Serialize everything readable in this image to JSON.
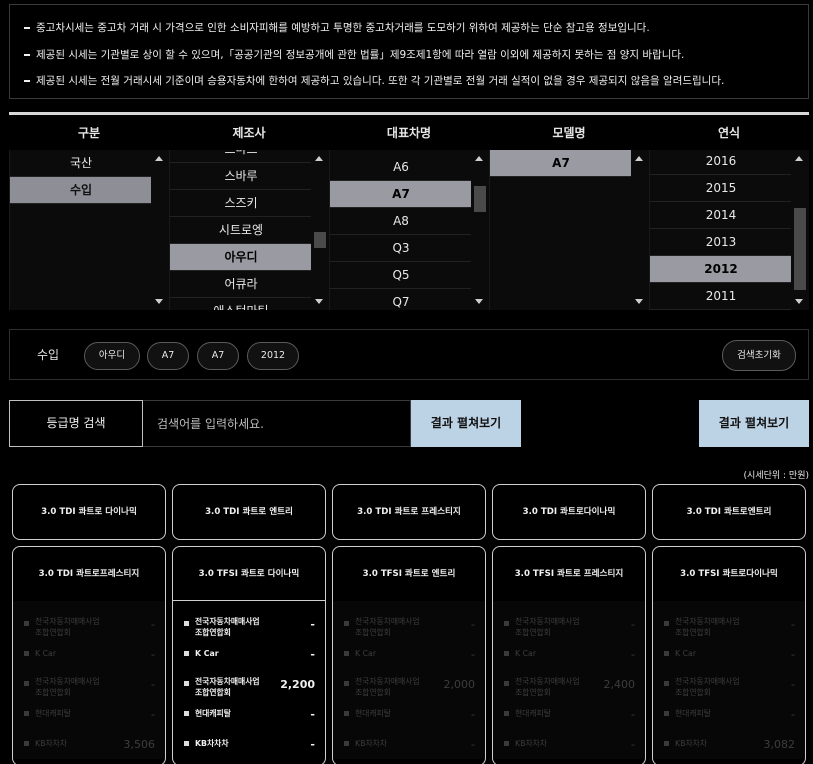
{
  "notice": [
    "중고차시세는 중고차 거래 시 가격으로 인한 소비자피해를 예방하고 투명한 중고차거래를 도모하기 위하여 제공하는 단순 참고용 정보입니다.",
    "제공된 시세는 기관별로 상이 할 수 있으며,「공공기관의 정보공개에 관한 법률」제9조제1항에 따라 열람 이외에 제공하지 못하는 점 양지 바랍니다.",
    "제공된 시세는 전월 거래시세 기준이며 승용자동차에 한하여 제공하고 있습니다. 또한 각 기관별로 전월 거래 실적이 없을 경우 제공되지 않음을 알려드립니다."
  ],
  "selector": {
    "headers": [
      "구분",
      "제조사",
      "대표차명",
      "모델명",
      "연식"
    ],
    "category": {
      "items": [
        "국산",
        "수입"
      ],
      "selected": 1
    },
    "maker": {
      "items": [
        "스마트",
        "스바루",
        "스즈키",
        "시트로엥",
        "아우디",
        "어큐라",
        "애스턴마틴"
      ],
      "selected": 4
    },
    "car": {
      "items": [
        "A6",
        "A7",
        "A8",
        "Q3",
        "Q5",
        "Q7"
      ],
      "selected": 1
    },
    "model": {
      "items": [
        "A7"
      ],
      "selected": 0
    },
    "year": {
      "items": [
        "2016",
        "2015",
        "2014",
        "2013",
        "2012",
        "2011"
      ],
      "selected": 4
    }
  },
  "chosen": {
    "label": "수입",
    "chips": [
      "아우디",
      "A7",
      "A7",
      "2012"
    ],
    "reset": "검색초기화"
  },
  "search": {
    "label": "등급명 검색",
    "placeholder": "검색어를 입력하세요.",
    "button1": "결과 펼쳐보기",
    "button2": "결과 펼쳐보기"
  },
  "unit": "(시세단위 : 만원)",
  "cards_row1": [
    "3.0 TDI 콰트로 다이나믹",
    "3.0 TDI 콰트로 엔트리",
    "3.0 TDI 콰트로 프레스티지",
    "3.0 TDI 콰트로다이나믹",
    "3.0 TDI 콰트로엔트리"
  ],
  "cards_row2": [
    {
      "title": "3.0 TDI 콰트로프레스티지",
      "active": false,
      "values": [
        "-",
        "-",
        "-",
        "-",
        "3,506"
      ]
    },
    {
      "title": "3.0 TFSI 콰트로 다이나믹",
      "active": true,
      "values": [
        "-",
        "-",
        "2,200",
        "-",
        "-"
      ]
    },
    {
      "title": "3.0 TFSI 콰트로 엔트리",
      "active": false,
      "values": [
        "-",
        "-",
        "2,000",
        "-",
        "-"
      ]
    },
    {
      "title": "3.0 TFSI 콰트로 프레스티지",
      "active": false,
      "values": [
        "-",
        "-",
        "2,400",
        "-",
        "-"
      ]
    },
    {
      "title": "3.0 TFSI 콰트로다이나믹",
      "active": false,
      "values": [
        "-",
        "-",
        "-",
        "-",
        "3,082"
      ]
    }
  ],
  "sources": [
    [
      "전국자동차매매사업",
      "조합연합회"
    ],
    [
      "K Car"
    ],
    [
      "전국자동차매매사업",
      "조합연합회"
    ],
    [
      "현대캐피탈"
    ],
    [
      "KB차차차"
    ]
  ]
}
